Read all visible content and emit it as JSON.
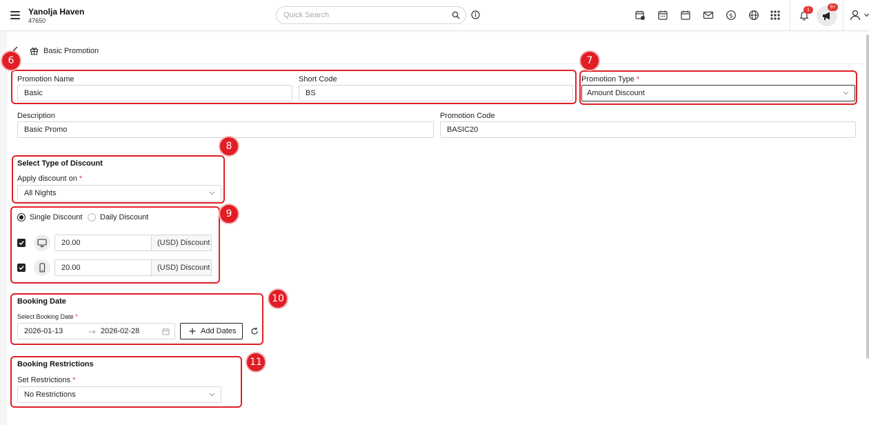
{
  "header": {
    "hotel_name": "Yanolja Haven",
    "hotel_id": "47650",
    "search_placeholder": "Quick Search",
    "notifications_count": "1",
    "announcements_count": "9+"
  },
  "page": {
    "title": "Basic Promotion"
  },
  "form": {
    "promotion_name_label": "Promotion Name",
    "promotion_name_value": "Basic",
    "short_code_label": "Short Code",
    "short_code_value": "BS",
    "promotion_type_label": "Promotion Type",
    "promotion_type_value": "Amount Discount",
    "description_label": "Description",
    "description_value": "Basic Promo",
    "promotion_code_label": "Promotion Code",
    "promotion_code_value": "BASIC20",
    "discount_section_title": "Select Type of Discount",
    "apply_discount_label": "Apply discount on",
    "apply_discount_value": "All Nights",
    "single_discount_label": "Single Discount",
    "daily_discount_label": "Daily Discount",
    "desktop_discount_value": "20.00",
    "mobile_discount_value": "20.00",
    "discount_unit_label": "(USD) Discount",
    "booking_date_title": "Booking Date",
    "select_booking_date_label": "Select Booking Date",
    "booking_date_start": "2026-01-13",
    "booking_date_end": "2026-02-28",
    "add_dates_label": "Add Dates",
    "booking_restrictions_title": "Booking Restrictions",
    "set_restrictions_label": "Set Restrictions",
    "set_restrictions_value": "No Restrictions",
    "required_mark": "*"
  },
  "annotations": [
    "6",
    "7",
    "8",
    "9",
    "10",
    "11"
  ],
  "colors": {
    "highlight": "#e11d25",
    "badge_red": "#e53935",
    "accent_dark": "#222222"
  }
}
